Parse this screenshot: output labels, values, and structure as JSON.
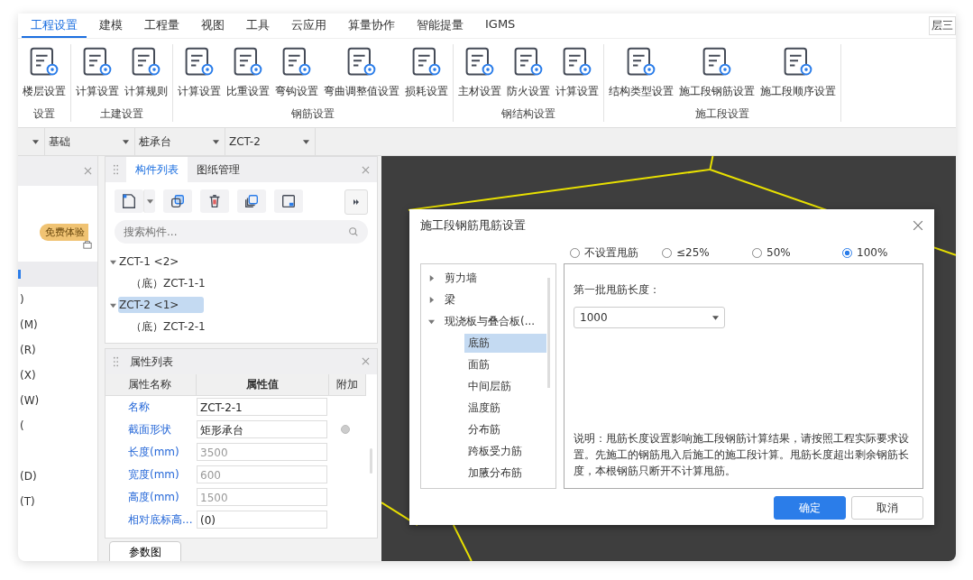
{
  "menu": [
    {
      "label": "工程设置",
      "selected": true
    },
    {
      "label": "建模",
      "selected": false
    },
    {
      "label": "工程量",
      "selected": false
    },
    {
      "label": "视图",
      "selected": false
    },
    {
      "label": "工具",
      "selected": false
    },
    {
      "label": "云应用",
      "selected": false
    },
    {
      "label": "算量协作",
      "selected": false
    },
    {
      "label": "智能提量",
      "selected": false
    },
    {
      "label": "IGMS",
      "selected": false
    }
  ],
  "floor_badge": "层三",
  "ribbon": [
    {
      "label": "设置",
      "buttons": [
        "楼层设置"
      ]
    },
    {
      "label": "土建设置",
      "buttons": [
        "计算设置",
        "计算规则"
      ]
    },
    {
      "label": "钢筋设置",
      "buttons": [
        "计算设置",
        "比重设置",
        "弯钩设置",
        "弯曲调整值设置",
        "损耗设置"
      ]
    },
    {
      "label": "钢结构设置",
      "buttons": [
        "主材设置",
        "防火设置",
        "计算设置"
      ]
    },
    {
      "label": "施工段设置",
      "buttons": [
        "结构类型设置",
        "施工段钢筋设置",
        "施工段顺序设置"
      ]
    }
  ],
  "selectors": [
    {
      "value": "基础"
    },
    {
      "value": "桩承台"
    },
    {
      "value": "ZCT-2"
    }
  ],
  "left_panel": {
    "badge": "免费体验",
    "items": [
      {
        "selected": false
      },
      {
        "selected": false
      },
      {
        "selected": false
      },
      {
        "selected": true
      },
      {
        "label": ")",
        "selected": false
      },
      {
        "label": "(M)",
        "selected": false
      },
      {
        "label": "(R)",
        "selected": false
      },
      {
        "label": "(X)",
        "selected": false
      },
      {
        "label": "(W)",
        "selected": false
      },
      {
        "label": "(",
        "selected": false
      },
      {
        "selected": false
      },
      {
        "label": "(D)",
        "selected": false
      },
      {
        "label": "(T)",
        "selected": false
      }
    ]
  },
  "component_panel": {
    "tabs": [
      {
        "label": "构件列表",
        "selected": true
      },
      {
        "label": "图纸管理",
        "selected": false
      }
    ],
    "search": {
      "placeholder": "搜索构件..."
    },
    "tree": [
      {
        "label": "ZCT-1 <2>",
        "selected": false,
        "expanded": true,
        "children": [
          {
            "label": "（底）ZCT-1-1",
            "selected": false
          }
        ]
      },
      {
        "label": "ZCT-2 <1>",
        "selected": true,
        "expanded": true,
        "children": [
          {
            "label": "（底）ZCT-2-1",
            "selected": false
          }
        ]
      }
    ]
  },
  "property_panel": {
    "title": "属性列表",
    "columns": [
      "属性名称",
      "属性值",
      "附加"
    ],
    "rows": [
      {
        "name": "名称",
        "value": "ZCT-2-1",
        "disabled": false,
        "attach": false
      },
      {
        "name": "截面形状",
        "value": "矩形承台",
        "disabled": false,
        "attach": true
      },
      {
        "name": "长度(mm)",
        "value": "3500",
        "disabled": true,
        "attach": false
      },
      {
        "name": "宽度(mm)",
        "value": "600",
        "disabled": true,
        "attach": false
      },
      {
        "name": "高度(mm)",
        "value": "1500",
        "disabled": true,
        "attach": false
      },
      {
        "name": "相对底标高...",
        "value": "(0)",
        "disabled": false,
        "attach": false
      }
    ],
    "button": "参数图"
  },
  "dialog": {
    "title": "施工段钢筋甩筋设置",
    "options": [
      {
        "label": "不设置甩筋",
        "selected": false
      },
      {
        "label": "≤25%",
        "selected": false
      },
      {
        "label": "50%",
        "selected": false
      },
      {
        "label": "100%",
        "selected": true
      }
    ],
    "tree": [
      {
        "label": "剪力墙",
        "expanded": false,
        "selected": false
      },
      {
        "label": "梁",
        "expanded": false,
        "selected": false
      },
      {
        "label": "现浇板与叠合板(...",
        "expanded": true,
        "selected": false,
        "children": [
          {
            "label": "底筋",
            "selected": true
          },
          {
            "label": "面筋",
            "selected": false
          },
          {
            "label": "中间层筋",
            "selected": false
          },
          {
            "label": "温度筋",
            "selected": false
          },
          {
            "label": "分布筋",
            "selected": false
          },
          {
            "label": "跨板受力筋",
            "selected": false
          },
          {
            "label": "加腋分布筋",
            "selected": false
          }
        ]
      }
    ],
    "field_label": "第一批甩筋长度：",
    "field_value": "1000",
    "note": "说明：甩筋长度设置影响施工段钢筋计算结果，请按照工程实际要求设置。先施工的钢筋甩入后施工的施工段计算。甩筋长度超出剩余钢筋长度，本根钢筋只断开不计算甩筋。",
    "buttons": [
      {
        "label": "确定",
        "kind": "primary"
      },
      {
        "label": "取消",
        "kind": "secondary"
      }
    ]
  }
}
